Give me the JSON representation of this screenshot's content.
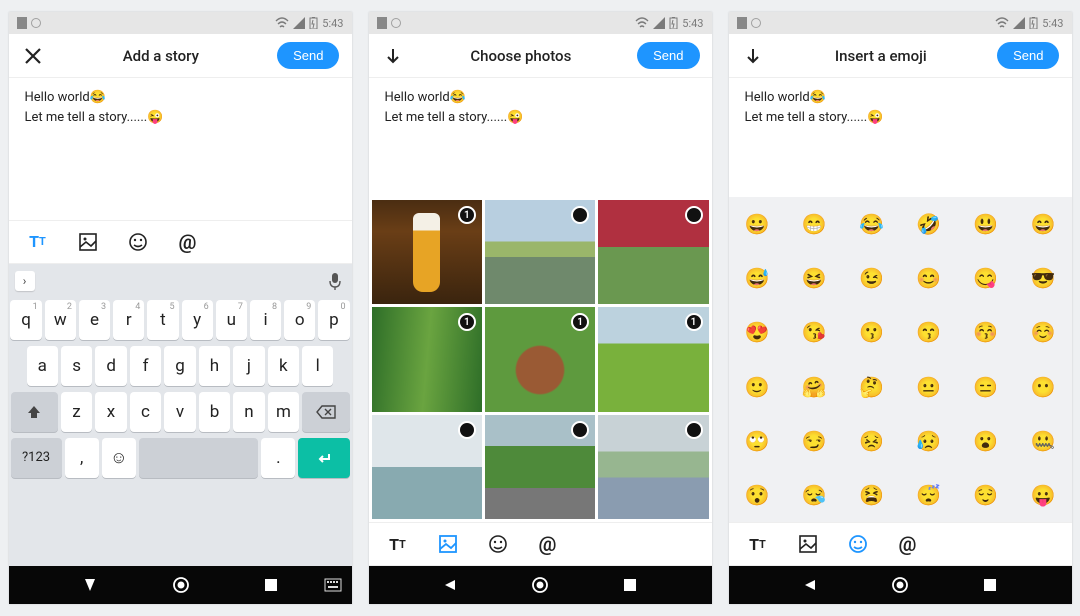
{
  "status": {
    "time": "5:43"
  },
  "header": {
    "send_label": "Send"
  },
  "editor": {
    "line1": "Hello world",
    "line1_emoji": "😂",
    "line2": "Let me tell a story......",
    "line2_emoji": "😜"
  },
  "screens": [
    {
      "title": "Add a story",
      "left_icon": "close",
      "active_mode": "text",
      "keyboard": {
        "row1": [
          {
            "main": "q",
            "sup": "1"
          },
          {
            "main": "w",
            "sup": "2"
          },
          {
            "main": "e",
            "sup": "3"
          },
          {
            "main": "r",
            "sup": "4"
          },
          {
            "main": "t",
            "sup": "5"
          },
          {
            "main": "y",
            "sup": "6"
          },
          {
            "main": "u",
            "sup": "7"
          },
          {
            "main": "i",
            "sup": "8"
          },
          {
            "main": "o",
            "sup": "9"
          },
          {
            "main": "p",
            "sup": "0"
          }
        ],
        "row2": [
          {
            "main": "a"
          },
          {
            "main": "s"
          },
          {
            "main": "d"
          },
          {
            "main": "f"
          },
          {
            "main": "g"
          },
          {
            "main": "h"
          },
          {
            "main": "j"
          },
          {
            "main": "k"
          },
          {
            "main": "l"
          }
        ],
        "row3": [
          {
            "main": "z"
          },
          {
            "main": "x"
          },
          {
            "main": "c"
          },
          {
            "main": "v"
          },
          {
            "main": "b"
          },
          {
            "main": "n"
          },
          {
            "main": "m"
          }
        ],
        "row4": {
          "num": "?123",
          "comma": ",",
          "period": "."
        }
      },
      "nav_style": "down-circle-square-keyboard"
    },
    {
      "title": "Choose photos",
      "left_icon": "arrow-down",
      "active_mode": "photo",
      "photos": [
        {
          "kind": "beer",
          "selected": true,
          "index": "1"
        },
        {
          "kind": "lake",
          "selected": false
        },
        {
          "kind": "flowers",
          "selected": false
        },
        {
          "kind": "bamboo",
          "selected": true,
          "index": "1"
        },
        {
          "kind": "rock",
          "selected": true,
          "index": "1"
        },
        {
          "kind": "field",
          "selected": true,
          "index": "1"
        },
        {
          "kind": "river",
          "selected": false
        },
        {
          "kind": "road",
          "selected": false
        },
        {
          "kind": "greenhouse",
          "selected": false
        }
      ],
      "nav_style": "back-circle-square"
    },
    {
      "title": "Insert a emoji",
      "left_icon": "arrow-down",
      "active_mode": "emoji",
      "emojis": [
        "😀",
        "😁",
        "😂",
        "🤣",
        "😃",
        "😄",
        "😅",
        "😆",
        "😉",
        "😊",
        "😋",
        "😎",
        "😍",
        "😘",
        "😗",
        "😙",
        "😚",
        "☺️",
        "🙂",
        "🤗",
        "🤔",
        "😐",
        "😑",
        "😶",
        "🙄",
        "😏",
        "😣",
        "😥",
        "😮",
        "🤐",
        "😯",
        "😪",
        "😫",
        "😴",
        "😌",
        "😛"
      ],
      "nav_style": "back-circle-square"
    }
  ]
}
